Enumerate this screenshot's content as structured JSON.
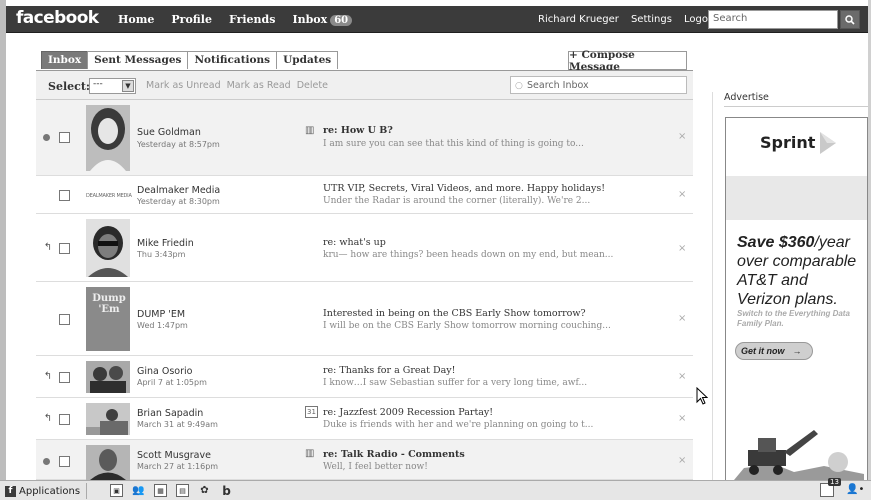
{
  "topbar": {
    "logo": "facebook",
    "nav": [
      "Home",
      "Profile",
      "Friends",
      "Inbox"
    ],
    "inbox_count": "60",
    "user": "Richard Krueger",
    "settings": "Settings",
    "logout": "Logout",
    "search_placeholder": "Search"
  },
  "tabs": [
    "Inbox",
    "Sent Messages",
    "Notifications",
    "Updates"
  ],
  "compose": "+ Compose Message",
  "toolbar": {
    "select_label": "Select:",
    "select_value": "---",
    "mark_unread": "Mark as Unread",
    "mark_read": "Mark as Read",
    "delete": "Delete",
    "search_placeholder": "Search Inbox"
  },
  "messages": [
    {
      "sender": "Sue Goldman",
      "time": "Yesterday at 8:57pm",
      "subject": "re: How U B?",
      "preview": "I am sure you can see that this kind of thing is going to...",
      "state": "unread"
    },
    {
      "sender": "Dealmaker Media",
      "time": "Yesterday at 8:30pm",
      "subject": "UTR VIP, Secrets, Viral Videos, and more. Happy holidays!",
      "preview": "Under the Radar is around the corner (literally). We're 2...",
      "state": "read",
      "logo_text": "DEALMAKER MEDIA"
    },
    {
      "sender": "Mike Friedin",
      "time": "Thu 3:43pm",
      "subject": "re: what's up",
      "preview": "kru— how are things? been heads down on my end, but mean...",
      "state": "replied"
    },
    {
      "sender": "DUMP 'EM",
      "time": "Wed 1:47pm",
      "subject": "Interested in being on the CBS Early Show tomorrow?",
      "preview": "I will be on the CBS Early Show tomorrow morning couching...",
      "state": "read",
      "thumb_text": "Dump 'Em"
    },
    {
      "sender": "Gina Osorio",
      "time": "April 7 at 1:05pm",
      "subject": "re: Thanks for a Great Day!",
      "preview": "I know…I saw Sebastian suffer for a very long time, awf...",
      "state": "replied"
    },
    {
      "sender": "Brian Sapadin",
      "time": "March 31 at 9:49am",
      "subject": "re: Jazzfest 2009 Recession Partay!",
      "preview": "Duke is friends with her and we're planning on going to t...",
      "state": "replied",
      "calendar_day": "31"
    },
    {
      "sender": "Scott Musgrave",
      "time": "March 27 at 1:16pm",
      "subject": "re: Talk Radio - Comments",
      "preview": "Well, I feel better now!",
      "state": "unread"
    }
  ],
  "sidebar": {
    "advertise": "Advertise",
    "ad": {
      "brand": "Sprint",
      "headline_bold": "Save $360",
      "headline_rest": "/year over comparable AT&T and Verizon plans.",
      "fine_print": "Switch to the Everything Data Family Plan.",
      "cta": "Get it now"
    }
  },
  "bottombar": {
    "applications": "Applications",
    "notifications_count": "13"
  },
  "colors": {
    "topbar": "#3b3b3b",
    "active_tab": "#7a7a7a",
    "unread_row": "#f2f2f2"
  }
}
